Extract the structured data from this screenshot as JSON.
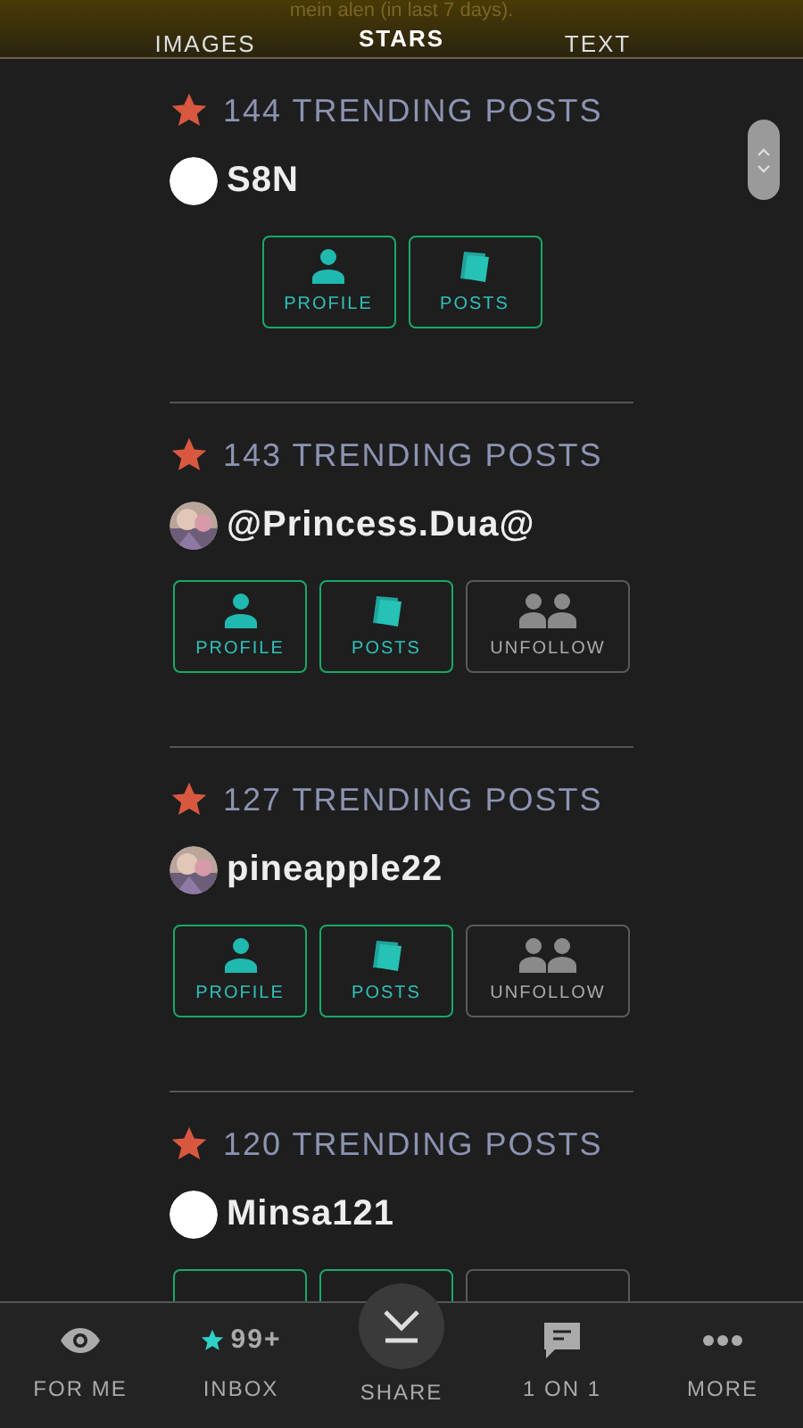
{
  "header": {
    "caption": "mein alen (in last 7 days).",
    "tabs": [
      {
        "label": "IMAGES",
        "selected": false
      },
      {
        "label": "STARS",
        "selected": true
      },
      {
        "label": "TEXT",
        "selected": false
      }
    ]
  },
  "cards": [
    {
      "count": "144 TRENDING POSTS",
      "user": "S8N",
      "avatar": {
        "kind": "plain"
      },
      "buttons": [
        {
          "kind": "profile",
          "label": "PROFILE"
        },
        {
          "kind": "posts",
          "label": "POSTS"
        }
      ]
    },
    {
      "count": "143 TRENDING POSTS",
      "user": "@Princess.Dua@",
      "avatar": {
        "kind": "picture"
      },
      "buttons": [
        {
          "kind": "profile",
          "label": "PROFILE"
        },
        {
          "kind": "posts",
          "label": "POSTS"
        },
        {
          "kind": "unfollow",
          "label": "UNFOLLOW"
        }
      ]
    },
    {
      "count": "127 TRENDING POSTS",
      "user": "pineapple22",
      "avatar": {
        "kind": "picture"
      },
      "buttons": [
        {
          "kind": "profile",
          "label": "PROFILE"
        },
        {
          "kind": "posts",
          "label": "POSTS"
        },
        {
          "kind": "unfollow",
          "label": "UNFOLLOW"
        }
      ]
    },
    {
      "count": "120 TRENDING POSTS",
      "user": "Minsa121",
      "avatar": {
        "kind": "plain"
      },
      "buttons": [
        {
          "kind": "profile"
        },
        {
          "kind": "posts"
        },
        {
          "kind": "unfollow"
        }
      ]
    }
  ],
  "nav": [
    {
      "kind": "eye",
      "label": "FOR ME"
    },
    {
      "kind": "inbox",
      "badge": "99+",
      "label": "INBOX"
    },
    {
      "kind": "share",
      "label": "SHARE"
    },
    {
      "kind": "chat",
      "label": "1 ON 1"
    },
    {
      "kind": "more",
      "label": "MORE"
    }
  ]
}
